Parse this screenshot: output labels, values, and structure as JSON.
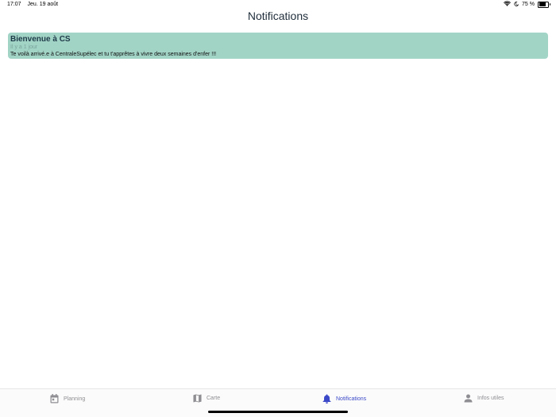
{
  "status_bar": {
    "time": "17:07",
    "date": "Jeu. 19 août",
    "battery": "75 %"
  },
  "header": {
    "title": "Notifications"
  },
  "notifications": [
    {
      "title": "Bienvenue à CS",
      "time": "Il y a 1 jour",
      "body": "Te voilà arrivé.e à CentraleSupélec et tu t'apprêtes à vivre deux semaines d'enfer !!!"
    }
  ],
  "tabs": [
    {
      "label": "Planning",
      "icon": "calendar-icon",
      "active": false
    },
    {
      "label": "Carte",
      "icon": "map-icon",
      "active": false
    },
    {
      "label": "Notifications",
      "icon": "bell-icon",
      "active": true
    },
    {
      "label": "Infos utiles",
      "icon": "person-icon",
      "active": false
    }
  ],
  "colors": {
    "card": "#a2d4c6",
    "active_tab": "#3b49c8",
    "inactive_tab": "#8e8e93"
  }
}
